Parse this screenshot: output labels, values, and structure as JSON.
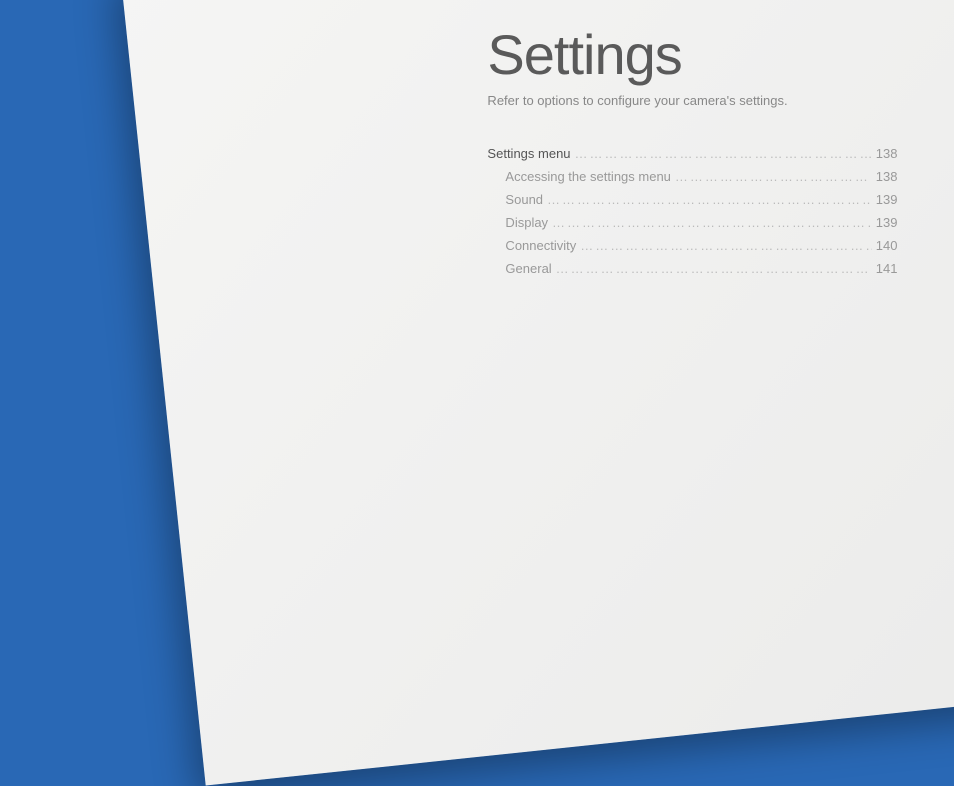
{
  "title": "Settings",
  "subtitle": "Refer to options to configure your camera's settings.",
  "toc": {
    "main": {
      "label": "Settings menu",
      "page": "138"
    },
    "subs": [
      {
        "label": "Accessing the settings menu",
        "page": "138"
      },
      {
        "label": "Sound",
        "page": "139"
      },
      {
        "label": "Display",
        "page": "139"
      },
      {
        "label": "Connectivity",
        "page": "140"
      },
      {
        "label": "General",
        "page": "141"
      }
    ]
  }
}
